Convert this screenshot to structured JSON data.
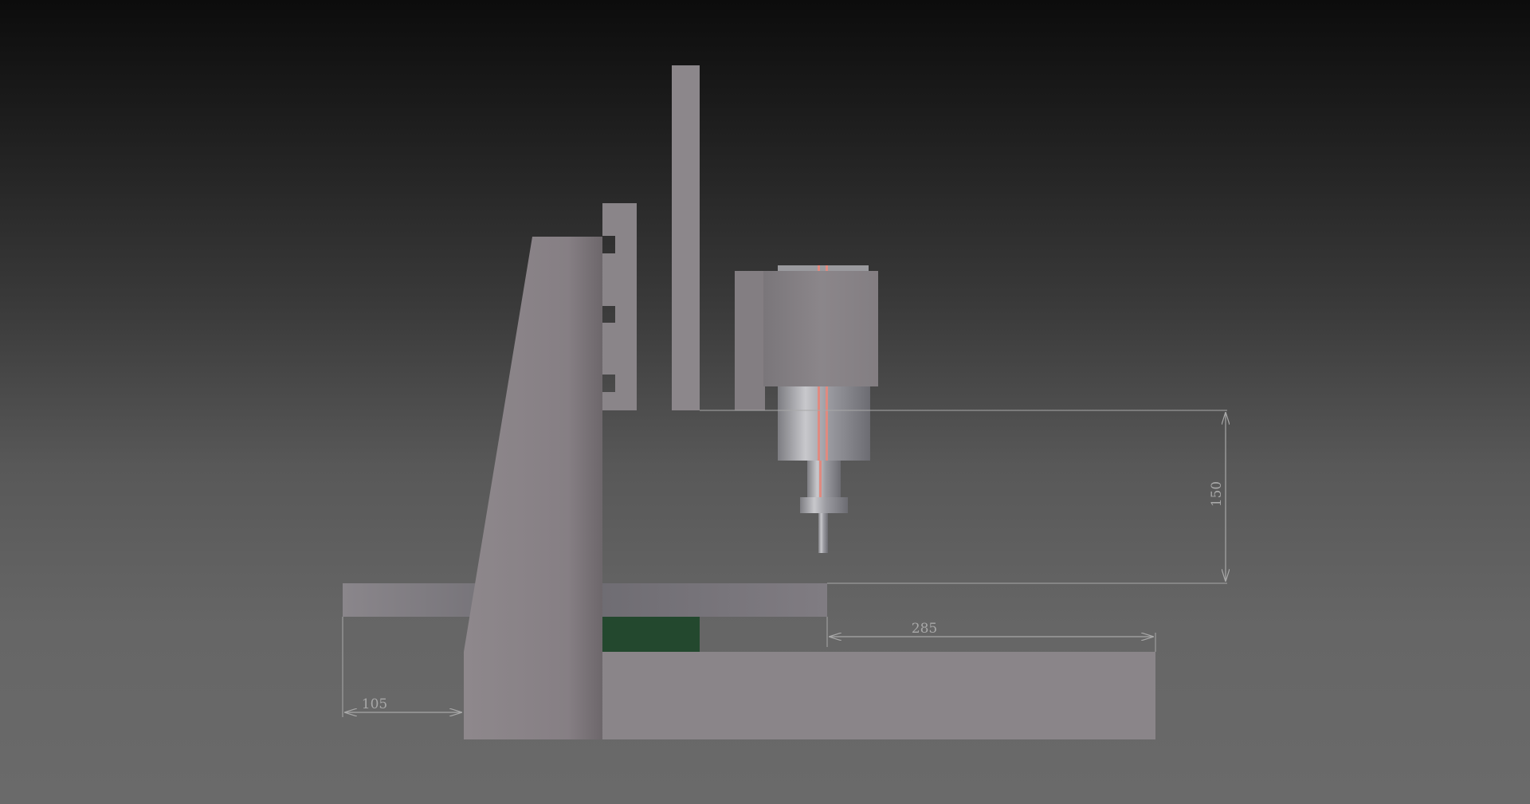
{
  "colors": {
    "frame": "#8b8589",
    "frame_dark": "#6e6a6d",
    "table_plate": "#7d7a80",
    "green_block": "#234a2f",
    "spindle_housing": "#898387",
    "dimension_line": "#a8a8a8",
    "tool_highlight": "#e08a80"
  },
  "dimensions": {
    "height": "150",
    "width": "285",
    "offset": "105"
  }
}
